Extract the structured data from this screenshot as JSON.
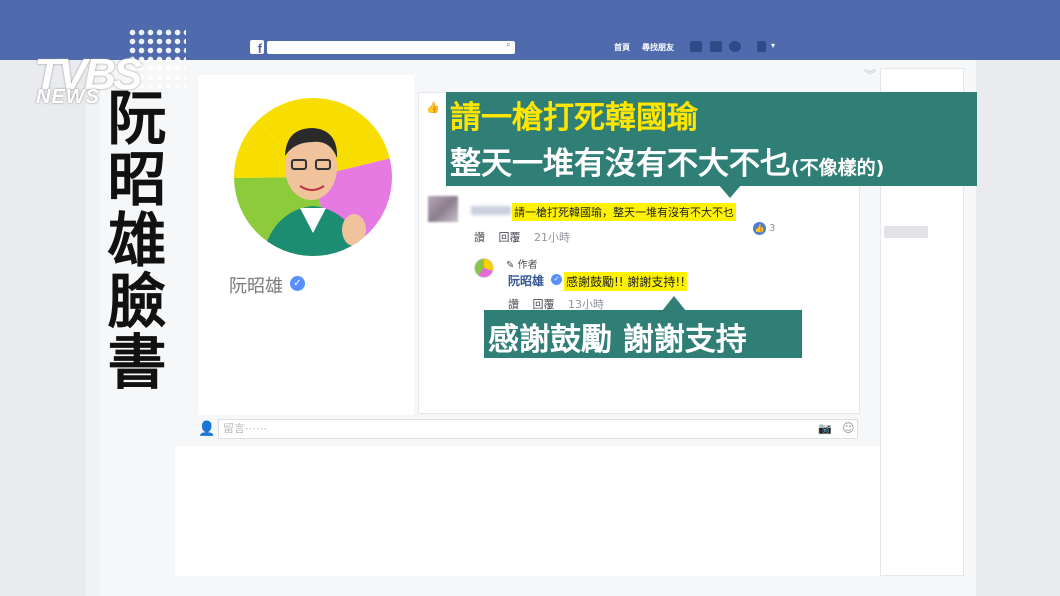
{
  "facebook": {
    "nav": {
      "home": "首頁",
      "find_friends": "尋找朋友"
    },
    "search_icon": "search-icon"
  },
  "broadcaster": {
    "logo": "TVBS",
    "logo_sub": "NEWS"
  },
  "overlay_title": [
    "阮",
    "昭",
    "雄",
    "臉",
    "書"
  ],
  "profile": {
    "name": "阮昭雄"
  },
  "comment": {
    "text": "請一槍打死韓國瑜，整天一堆有沒有不大不乜",
    "like_label": "讚",
    "reply_label": "回覆",
    "time": "21小時",
    "like_count": "3"
  },
  "reply": {
    "author_tag": "作者",
    "name": "阮昭雄",
    "text": "感謝鼓勵!! 謝謝支持!!",
    "like_label": "讚",
    "reply_label": "回覆",
    "time": "13小時"
  },
  "comment_input": {
    "placeholder": "留言⋯⋯"
  },
  "callouts": {
    "comment_line1": "請一槍打死韓國瑜",
    "comment_line2": "整天一堆有沒有不大不乜",
    "comment_line2_note": "(不像樣的)",
    "reply": "感謝鼓勵 謝謝支持"
  },
  "colors": {
    "facebook_blue": "#4f6aad",
    "callout_green": "#2f7f77",
    "highlight_yellow": "#fff200",
    "callout_yellow_text": "#ffe600"
  }
}
